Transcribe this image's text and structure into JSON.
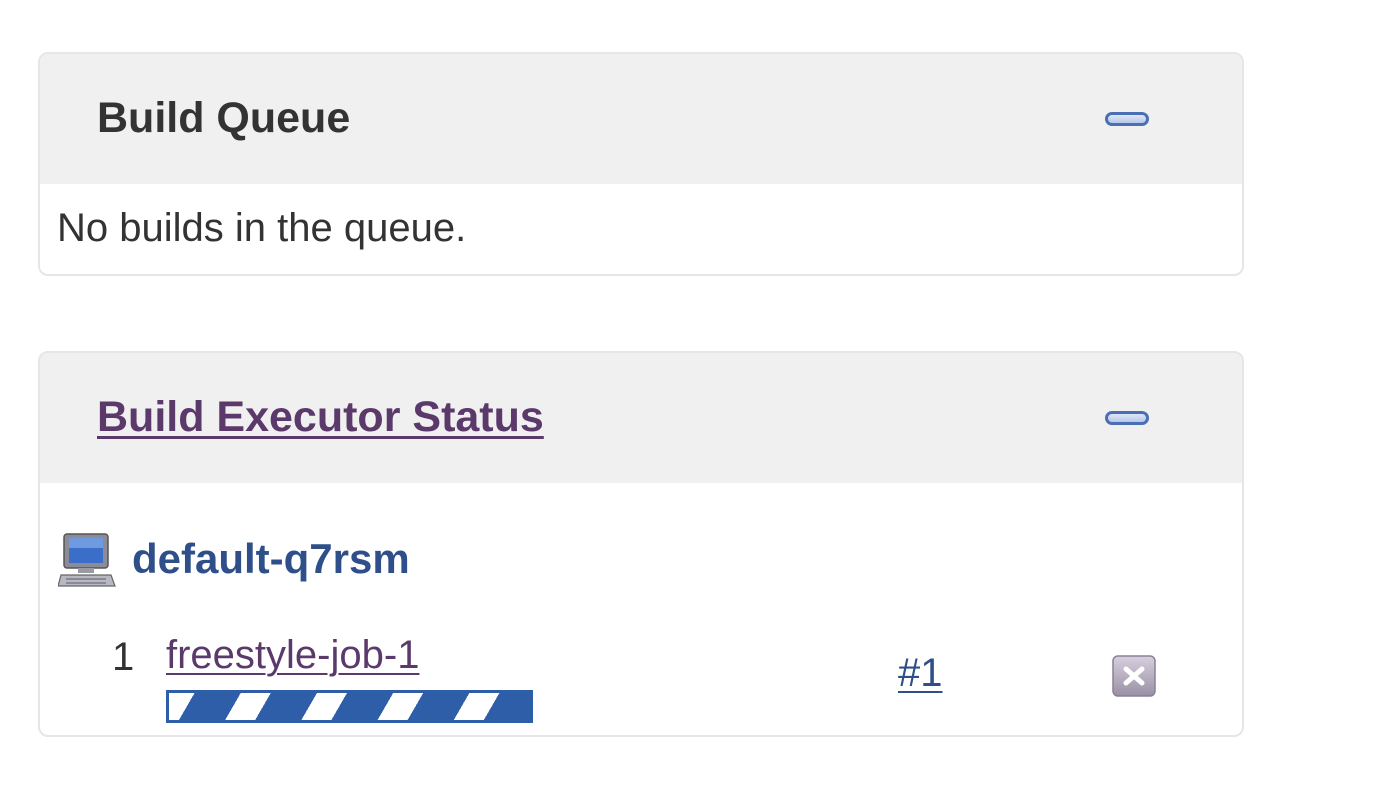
{
  "build_queue": {
    "title": "Build Queue",
    "empty_message": "No builds in the queue."
  },
  "executor_status": {
    "title": "Build Executor Status",
    "node": {
      "name": "default-q7rsm",
      "icon": "computer-icon"
    },
    "executors": [
      {
        "number": "1",
        "job_name": "freestyle-job-1",
        "build_number": "#1",
        "stop_icon": "stop-icon",
        "progress_indeterminate": true
      }
    ]
  },
  "colors": {
    "header_bg": "#f0f0f0",
    "title_text": "#333333",
    "visited_link": "#5b3a6b",
    "link": "#2e4f8a",
    "progress": "#2f5ea8"
  }
}
